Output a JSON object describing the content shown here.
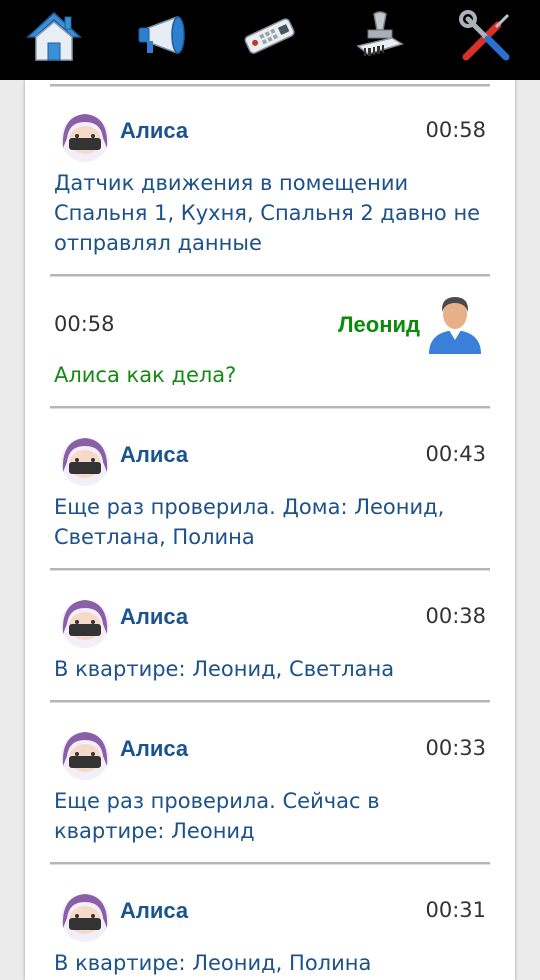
{
  "toolbar": {
    "items": [
      {
        "icon": "home-icon"
      },
      {
        "icon": "megaphone-icon"
      },
      {
        "icon": "remote-control-icon"
      },
      {
        "icon": "stamp-icon"
      },
      {
        "icon": "tools-icon"
      }
    ]
  },
  "colors": {
    "bot_text": "#1c5189",
    "bot_name": "#1a5390",
    "user_text": "#138a13",
    "user_name": "#0b8a0b",
    "topbar": "#000000"
  },
  "messages": [
    {
      "sender": "Алиса",
      "time": "00:58",
      "lines": [
        "Датчик движения в помещении",
        "Спальня 1, Кухня, Спальня 2 давно не",
        "отправлял данные"
      ]
    },
    {
      "sender": "Леонид",
      "time": "00:58",
      "lines": [
        "Алиса как дела?"
      ]
    },
    {
      "sender": "Алиса",
      "time": "00:43",
      "lines": [
        "Еще раз проверила. Дома: Леонид,",
        "Светлана, Полина"
      ]
    },
    {
      "sender": "Алиса",
      "time": "00:38",
      "lines": [
        "В квартире: Леонид, Светлана"
      ]
    },
    {
      "sender": "Алиса",
      "time": "00:33",
      "lines": [
        "Еще раз проверила. Сейчас в",
        "квартире: Леонид"
      ]
    },
    {
      "sender": "Алиса",
      "time": "00:31",
      "lines": [
        "В квартире: Леонид, Полина"
      ]
    }
  ]
}
